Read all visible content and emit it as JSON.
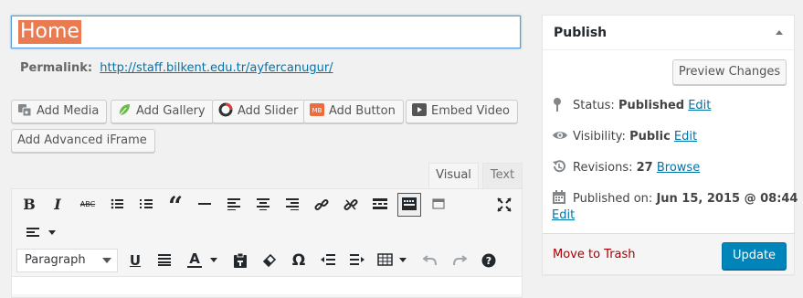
{
  "title": {
    "value": "Home"
  },
  "permalink": {
    "label": "Permalink:",
    "url": "http://staff.bilkent.edu.tr/ayfercanugur/"
  },
  "media_buttons": [
    {
      "label": "Add Media",
      "icon": "media-icon"
    },
    {
      "label": "Add Gallery",
      "icon": "gallery-leaf-icon"
    },
    {
      "label": "Add Slider",
      "icon": "slider-icon"
    },
    {
      "label": "Add Button",
      "icon": "button-icon"
    },
    {
      "label": "Embed Video",
      "icon": "video-icon"
    },
    {
      "label": "Add Advanced iFrame",
      "icon": ""
    }
  ],
  "editor_tabs": {
    "visual": "Visual",
    "text": "Text"
  },
  "toolbar": {
    "format_value": "Paragraph",
    "row1_icons": [
      "bold-icon",
      "italic-icon",
      "strikethrough-icon",
      "bullet-list-icon",
      "numbered-list-icon",
      "blockquote-icon",
      "horizontal-rule-icon",
      "align-left-icon",
      "align-center-icon",
      "align-right-icon",
      "link-icon",
      "unlink-icon",
      "read-more-icon",
      "toolbar-toggle-icon",
      "table-grid-icon",
      "fullscreen-icon",
      "align-dropdown-icon"
    ],
    "row2_icons": [
      "underline-icon",
      "justify-icon",
      "text-color-icon",
      "paste-text-icon",
      "clear-format-icon",
      "special-char-icon",
      "outdent-icon",
      "indent-icon",
      "table-icon",
      "undo-icon",
      "redo-icon",
      "help-icon"
    ],
    "bold": "B",
    "italic": "I",
    "strike": "ABC",
    "quote": "“",
    "underline": "U",
    "color": "A",
    "omega": "Ω"
  },
  "publish": {
    "title": "Publish",
    "preview_label": "Preview Changes",
    "status": {
      "label": "Status:",
      "value": "Published",
      "edit": "Edit"
    },
    "visibility": {
      "label": "Visibility:",
      "value": "Public",
      "edit": "Edit"
    },
    "revisions": {
      "label": "Revisions:",
      "value": "27",
      "link": "Browse"
    },
    "published_on": {
      "label": "Published on:",
      "value": "Jun 15, 2015 @ 08:44",
      "edit": "Edit"
    },
    "trash_label": "Move to Trash",
    "update_label": "Update"
  },
  "colors": {
    "accent": "#0085ba",
    "link": "#0073aa",
    "trash": "#aa0000",
    "selection": "#ea7a50"
  }
}
